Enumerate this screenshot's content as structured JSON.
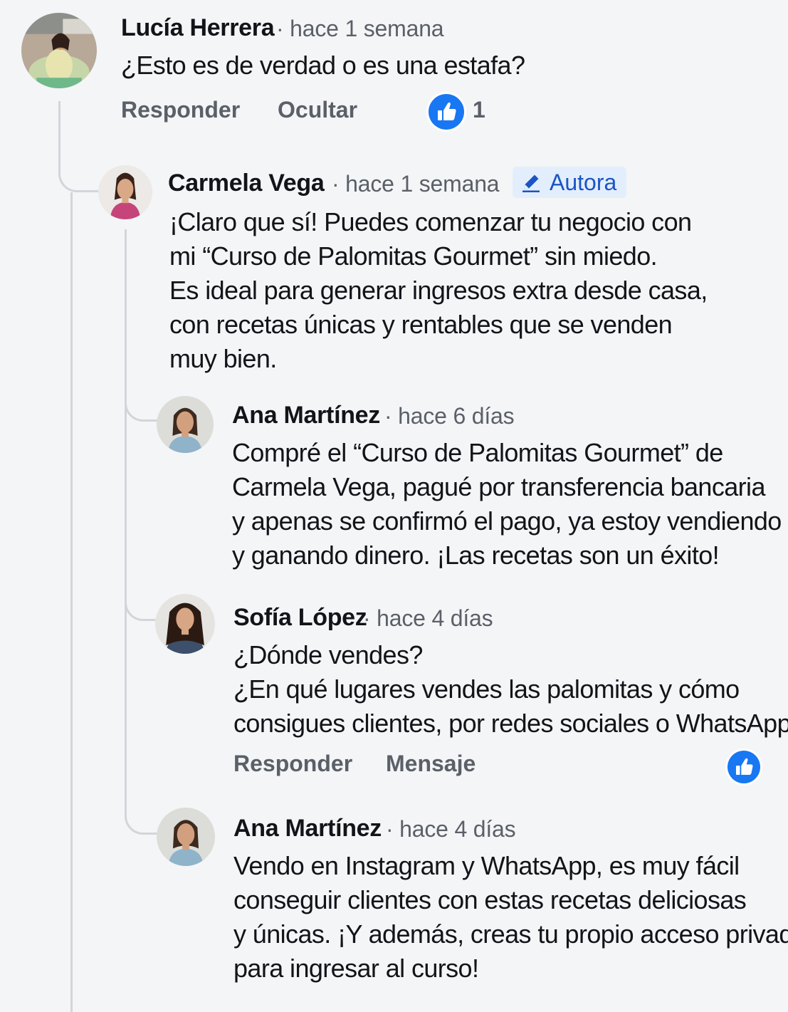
{
  "comments": [
    {
      "author": "Lucía Herrera",
      "time": "hace 1 semana",
      "lines": [
        "¿Esto es de verdad o es una estafa?"
      ],
      "actions": {
        "reply": "Responder",
        "hide": "Ocultar"
      },
      "like_count": "1"
    },
    {
      "author": "Carmela Vega",
      "time": "hace 1 semana",
      "badge": "Autora",
      "lines": [
        "¡Claro que sí! Puedes comenzar tu negocio con",
        "mi “Curso de Palomitas Gourmet” sin miedo.",
        "Es ideal para generar ingresos extra desde casa,",
        "con recetas únicas y rentables que se venden",
        "muy bien."
      ]
    },
    {
      "author": "Ana Martínez",
      "time": "hace 6 días",
      "lines": [
        "Compré el “Curso de Palomitas Gourmet” de",
        "Carmela Vega, pagué por transferencia bancaria",
        "y apenas se confirmó el pago, ya estoy vendiendo",
        "y ganando dinero. ¡Las recetas son un éxito!"
      ]
    },
    {
      "author": "Sofía López",
      "time": "hace 4 días",
      "lines": [
        "¿Dónde vendes?",
        "¿En qué lugares vendes las palomitas y cómo",
        "consigues clientes, por redes sociales o WhatsApp?"
      ],
      "actions": {
        "reply": "Responder",
        "message": "Mensaje"
      }
    },
    {
      "author": "Ana Martínez",
      "time": "hace 4 días",
      "lines": [
        "Vendo en Instagram y WhatsApp, es muy fácil",
        "conseguir clientes con estas recetas deliciosas",
        "y únicas. ¡Y además, creas tu propio acceso privado",
        "para ingresar al curso!"
      ]
    }
  ],
  "separator": "·",
  "icons": {
    "like": "thumbs-up-icon",
    "badge": "pencil-icon",
    "avatar": "avatar-photo"
  },
  "colors": {
    "background": "#f4f5f7",
    "like_blue": "#1877f2",
    "badge_bg": "#e3eefd",
    "badge_text": "#1b54c5",
    "meta_text": "#5b6068",
    "thread_line": "#d2d5da"
  }
}
